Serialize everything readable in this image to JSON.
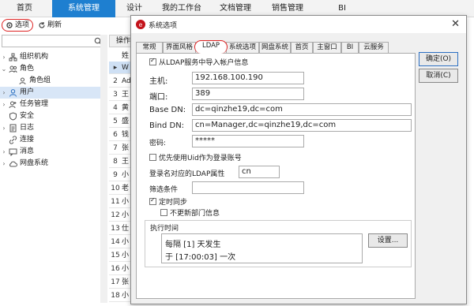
{
  "topnav": {
    "items": [
      {
        "label": "首页"
      },
      {
        "label": "系统管理"
      },
      {
        "label": "设计"
      },
      {
        "label": "我的工作台"
      },
      {
        "label": "文档管理"
      },
      {
        "label": "销售管理"
      },
      {
        "label": "BI"
      }
    ]
  },
  "toolbar": {
    "options_label": "选项",
    "refresh_label": "刷新"
  },
  "tree": {
    "items": [
      {
        "label": "组织机构"
      },
      {
        "label": "角色"
      },
      {
        "label": "角色组"
      },
      {
        "label": "用户"
      },
      {
        "label": "任务管理"
      },
      {
        "label": "安全"
      },
      {
        "label": "日志"
      },
      {
        "label": "连接"
      },
      {
        "label": "消息"
      },
      {
        "label": "网盘系统"
      }
    ]
  },
  "grid": {
    "header_partial": "操作",
    "col_partial": "姓",
    "rows": [
      "W",
      "Ad",
      "王",
      "黄",
      "盛",
      "钱",
      "张",
      "王",
      "小",
      "老",
      "小",
      "小",
      "仕",
      "小",
      "小",
      "小",
      "张",
      "小"
    ]
  },
  "dialog": {
    "title": "系统选项",
    "tabs": [
      "常规",
      "界面风格",
      "LDAP",
      "系统选项",
      "网盘系统",
      "首页",
      "主窗口",
      "BI",
      "云服务"
    ],
    "ok_label": "确定(O)",
    "cancel_label": "取消(C)",
    "import_checkbox": "从LDAP服务中导入帐户信息",
    "host_label": "主机:",
    "host_value": "192.168.100.190",
    "port_label": "端口:",
    "port_value": "389",
    "basedn_label": "Base DN:",
    "basedn_value": "dc=qinzhe19,dc=com",
    "binddn_label": "Bind DN:",
    "binddn_value": "cn=Manager,dc=qinzhe19,dc=com",
    "password_label": "密码:",
    "password_value": "*****",
    "uid_checkbox": "优先使用Uid作为登录账号",
    "ldap_attr_label": "登录名对应的LDAP属性",
    "ldap_attr_value": "cn",
    "filter_label": "筛选条件",
    "filter_value": "",
    "sync_checkbox": "定时同步",
    "no_dept_checkbox": "不更新部门信息",
    "schedule_label": "执行时间",
    "schedule_line1": "每隔 [1] 天发生",
    "schedule_line2": "于 [17:00:03] 一次",
    "settings_button": "设置..."
  },
  "colors": {
    "accent": "#1e7fd0",
    "highlight": "#d22222"
  }
}
